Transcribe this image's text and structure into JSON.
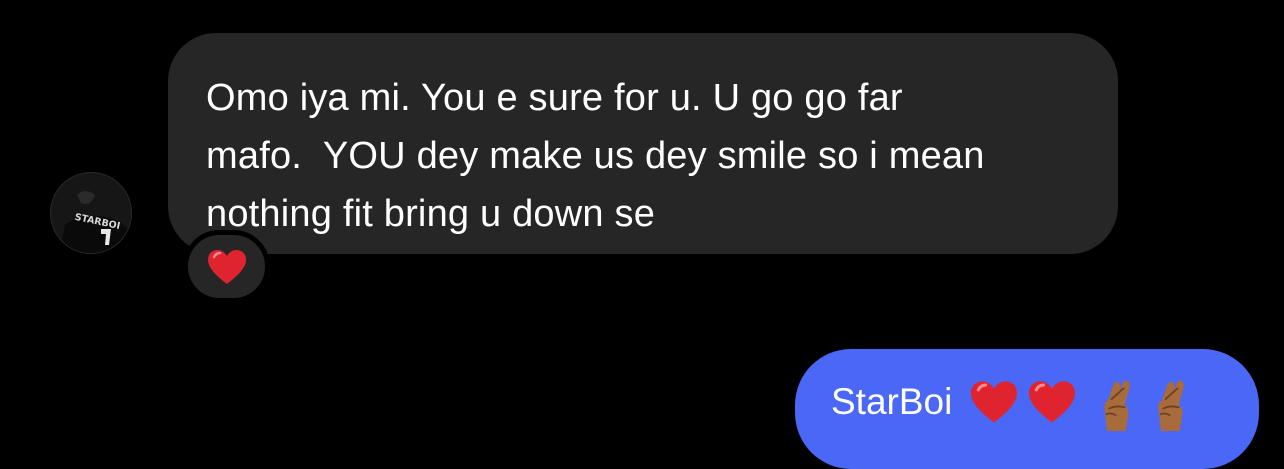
{
  "conversation": {
    "received_message": {
      "sender_avatar": "starboi-avatar",
      "text": "Omo iya mi. You e sure for u. U go go far\nmafo.  YOU dey make us dey smile so i mean\nnothing fit bring u down se",
      "reaction": "red-heart-icon"
    },
    "sent_message": {
      "text": "StarBoi",
      "emojis": [
        "red-heart-icon",
        "red-heart-icon",
        "crossed-fingers-icon",
        "crossed-fingers-icon"
      ]
    }
  },
  "colors": {
    "background": "#000000",
    "received_bubble": "#262626",
    "sent_bubble": "#4a67f5",
    "heart": "#e0242f",
    "skin_tone": "#a86b3c"
  }
}
